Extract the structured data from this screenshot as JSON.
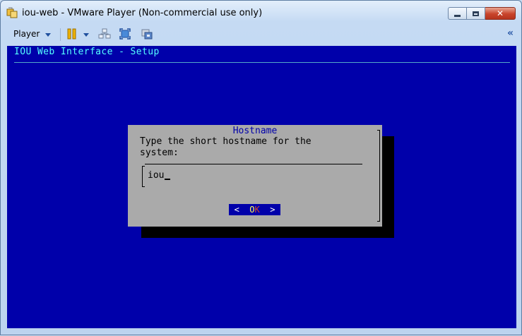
{
  "window": {
    "title": "iou-web - VMware Player (Non-commercial use only)"
  },
  "toolbar": {
    "player_label": "Player",
    "collapse_glyph": "«",
    "icons": [
      "pause-icon",
      "send-ctrl-alt-del-icon",
      "fullscreen-icon",
      "unity-icon"
    ]
  },
  "console": {
    "header": "IOU Web Interface - Setup",
    "dialog": {
      "title": "Hostname",
      "prompt": "Type the short hostname for the\nsystem:",
      "input_value": "iou",
      "ok_left": "<",
      "ok_o": "O",
      "ok_k": "K",
      "ok_right": ">"
    }
  },
  "colors": {
    "console_bg": "#0000aa",
    "dialog_bg": "#aaaaaa",
    "header_text": "#55ffff",
    "close_button": "#c8442b"
  }
}
